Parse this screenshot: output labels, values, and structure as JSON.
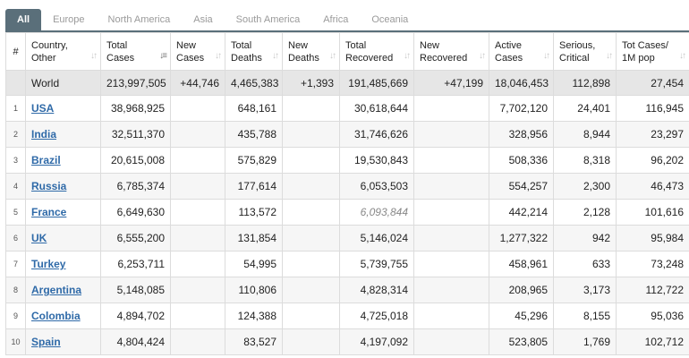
{
  "tabs": [
    {
      "label": "All",
      "active": true
    },
    {
      "label": "Europe",
      "active": false
    },
    {
      "label": "North America",
      "active": false
    },
    {
      "label": "Asia",
      "active": false
    },
    {
      "label": "South America",
      "active": false
    },
    {
      "label": "Africa",
      "active": false
    },
    {
      "label": "Oceania",
      "active": false
    }
  ],
  "table": {
    "headers": {
      "idx": "#",
      "country": [
        "Country,",
        "Other"
      ],
      "total_cases": [
        "Total",
        "Cases"
      ],
      "new_cases": [
        "New",
        "Cases"
      ],
      "total_deaths": [
        "Total",
        "Deaths"
      ],
      "new_deaths": [
        "New",
        "Deaths"
      ],
      "total_recovered": [
        "Total",
        "Recovered"
      ],
      "new_recovered": [
        "New",
        "Recovered"
      ],
      "active_cases": [
        "Active",
        "Cases"
      ],
      "serious": [
        "Serious,",
        "Critical"
      ],
      "tot_cases_1m": [
        "Tot Cases/",
        "1M pop"
      ]
    },
    "world": {
      "name": "World",
      "total_cases": "213,997,505",
      "new_cases": "+44,746",
      "total_deaths": "4,465,383",
      "new_deaths": "+1,393",
      "total_recovered": "191,485,669",
      "new_recovered": "+47,199",
      "active_cases": "18,046,453",
      "serious": "112,898",
      "tot_cases_1m": "27,454"
    },
    "rows": [
      {
        "idx": "1",
        "name": "USA",
        "total_cases": "38,968,925",
        "new_cases": "",
        "total_deaths": "648,161",
        "new_deaths": "",
        "total_recovered": "30,618,644",
        "new_recovered": "",
        "active_cases": "7,702,120",
        "serious": "24,401",
        "tot_cases_1m": "116,945"
      },
      {
        "idx": "2",
        "name": "India",
        "total_cases": "32,511,370",
        "new_cases": "",
        "total_deaths": "435,788",
        "new_deaths": "",
        "total_recovered": "31,746,626",
        "new_recovered": "",
        "active_cases": "328,956",
        "serious": "8,944",
        "tot_cases_1m": "23,297"
      },
      {
        "idx": "3",
        "name": "Brazil",
        "total_cases": "20,615,008",
        "new_cases": "",
        "total_deaths": "575,829",
        "new_deaths": "",
        "total_recovered": "19,530,843",
        "new_recovered": "",
        "active_cases": "508,336",
        "serious": "8,318",
        "tot_cases_1m": "96,202"
      },
      {
        "idx": "4",
        "name": "Russia",
        "total_cases": "6,785,374",
        "new_cases": "",
        "total_deaths": "177,614",
        "new_deaths": "",
        "total_recovered": "6,053,503",
        "new_recovered": "",
        "active_cases": "554,257",
        "serious": "2,300",
        "tot_cases_1m": "46,473"
      },
      {
        "idx": "5",
        "name": "France",
        "total_cases": "6,649,630",
        "new_cases": "",
        "total_deaths": "113,572",
        "new_deaths": "",
        "total_recovered": "6,093,844",
        "new_recovered": "",
        "active_cases": "442,214",
        "serious": "2,128",
        "tot_cases_1m": "101,616",
        "recovered_italic": true
      },
      {
        "idx": "6",
        "name": "UK",
        "total_cases": "6,555,200",
        "new_cases": "",
        "total_deaths": "131,854",
        "new_deaths": "",
        "total_recovered": "5,146,024",
        "new_recovered": "",
        "active_cases": "1,277,322",
        "serious": "942",
        "tot_cases_1m": "95,984"
      },
      {
        "idx": "7",
        "name": "Turkey",
        "total_cases": "6,253,711",
        "new_cases": "",
        "total_deaths": "54,995",
        "new_deaths": "",
        "total_recovered": "5,739,755",
        "new_recovered": "",
        "active_cases": "458,961",
        "serious": "633",
        "tot_cases_1m": "73,248"
      },
      {
        "idx": "8",
        "name": "Argentina",
        "total_cases": "5,148,085",
        "new_cases": "",
        "total_deaths": "110,806",
        "new_deaths": "",
        "total_recovered": "4,828,314",
        "new_recovered": "",
        "active_cases": "208,965",
        "serious": "3,173",
        "tot_cases_1m": "112,722"
      },
      {
        "idx": "9",
        "name": "Colombia",
        "total_cases": "4,894,702",
        "new_cases": "",
        "total_deaths": "124,388",
        "new_deaths": "",
        "total_recovered": "4,725,018",
        "new_recovered": "",
        "active_cases": "45,296",
        "serious": "8,155",
        "tot_cases_1m": "95,036"
      },
      {
        "idx": "10",
        "name": "Spain",
        "total_cases": "4,804,424",
        "new_cases": "",
        "total_deaths": "83,527",
        "new_deaths": "",
        "total_recovered": "4,197,092",
        "new_recovered": "",
        "active_cases": "523,805",
        "serious": "1,769",
        "tot_cases_1m": "102,712"
      }
    ]
  },
  "icons": {
    "sort": "sort-arrows-icon",
    "sort_active": "sort-descending-icon"
  }
}
